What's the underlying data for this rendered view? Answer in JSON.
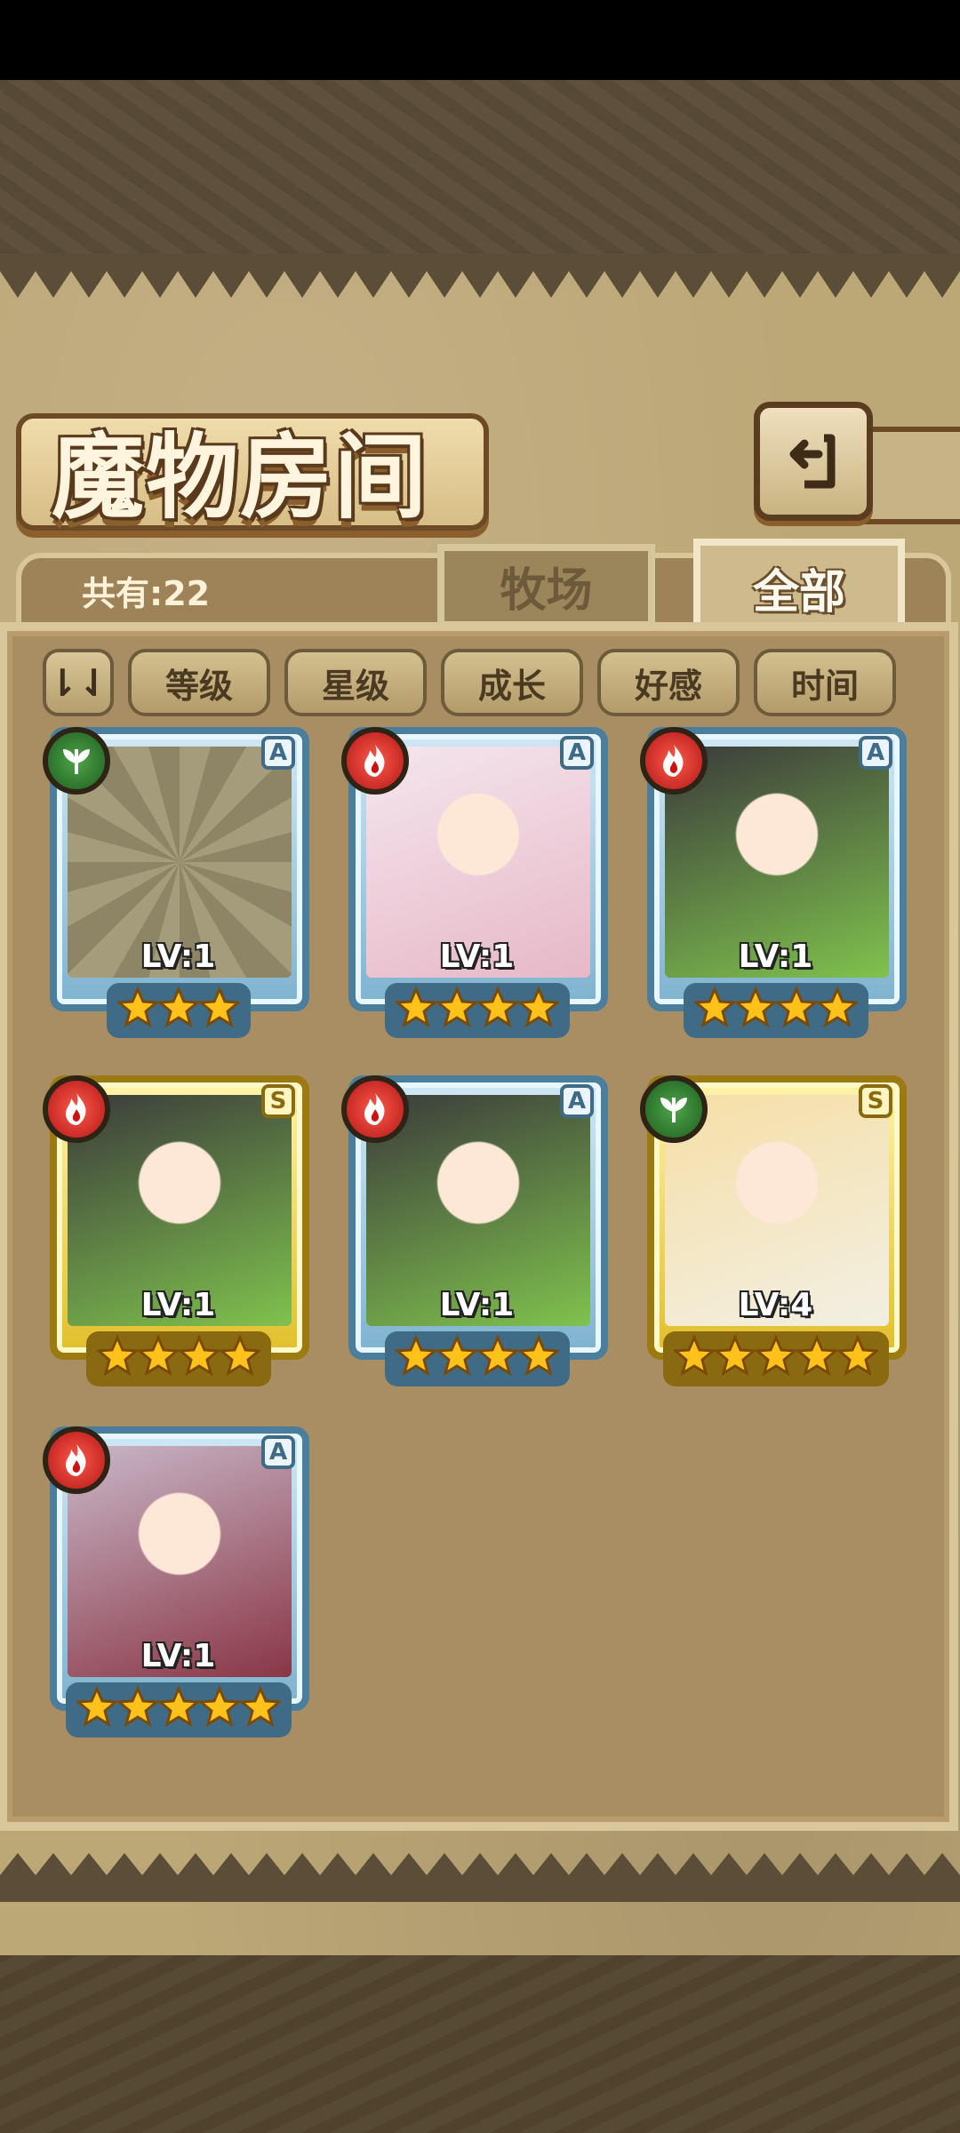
{
  "title": "魔物房间",
  "header": {
    "count_label": "共有:22"
  },
  "tabs": [
    {
      "label": "牧场",
      "active": false
    },
    {
      "label": "全部",
      "active": true
    }
  ],
  "sort": {
    "toggle_label": "⇂⇃",
    "buttons": [
      "等级",
      "星级",
      "成长",
      "好感",
      "时间"
    ]
  },
  "cards": [
    {
      "level": "LV:1",
      "rank": "A",
      "element": "leaf-icon",
      "stars": 3,
      "frame": "blue",
      "portrait": "locked-silhouette"
    },
    {
      "level": "LV:1",
      "rank": "A",
      "element": "fire-icon",
      "stars": 4,
      "frame": "blue",
      "portrait": "white-hair-girl"
    },
    {
      "level": "LV:1",
      "rank": "A",
      "element": "fire-icon",
      "stars": 4,
      "frame": "blue",
      "portrait": "black-green-hair-girl"
    },
    {
      "level": "LV:1",
      "rank": "S",
      "element": "fire-icon",
      "stars": 4,
      "frame": "gold",
      "portrait": "black-green-hair-girl"
    },
    {
      "level": "LV:1",
      "rank": "A",
      "element": "fire-icon",
      "stars": 4,
      "frame": "blue",
      "portrait": "black-green-hair-girl"
    },
    {
      "level": "LV:4",
      "rank": "S",
      "element": "leaf-icon",
      "stars": 5,
      "frame": "gold",
      "portrait": "blonde-girl"
    },
    {
      "level": "LV:1",
      "rank": "A",
      "element": "fire-icon",
      "stars": 5,
      "frame": "blue",
      "portrait": "horned-demon-girl"
    }
  ],
  "colors": {
    "fire": "#d11f1f",
    "leaf": "#2f7a2f",
    "star": "#ffc21a"
  }
}
